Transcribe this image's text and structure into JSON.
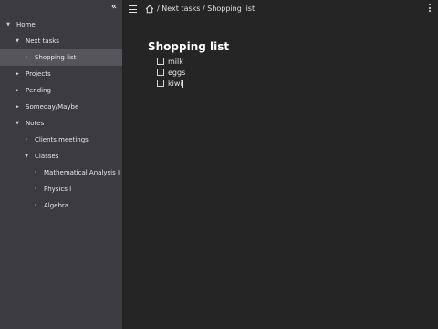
{
  "sidebar": {
    "collapse_icon": "chevron-double-left-icon",
    "items": [
      {
        "id": "home",
        "label": "Home",
        "expanded": true
      },
      {
        "id": "next-tasks",
        "label": "Next tasks",
        "expanded": true
      },
      {
        "id": "shopping-list",
        "label": "Shopping list",
        "selected": true
      },
      {
        "id": "projects",
        "label": "Projects",
        "expanded": false
      },
      {
        "id": "pending",
        "label": "Pending",
        "expanded": false
      },
      {
        "id": "someday-maybe",
        "label": "Someday/Maybe",
        "expanded": false
      },
      {
        "id": "notes",
        "label": "Notes",
        "expanded": true
      },
      {
        "id": "clients-meetings",
        "label": "Clients meetings"
      },
      {
        "id": "classes",
        "label": "Classes",
        "expanded": true
      },
      {
        "id": "mathematical-analysis-i",
        "label": "Mathematical Analysis I"
      },
      {
        "id": "physics-i",
        "label": "Physics I"
      },
      {
        "id": "algebra",
        "label": "Algebra"
      }
    ]
  },
  "topbar": {
    "menu_icon": "hamburger-menu-icon",
    "home_icon": "home-icon",
    "breadcrumb": [
      {
        "label": "Next tasks"
      },
      {
        "label": "Shopping list"
      }
    ],
    "separator": "/",
    "more_icon": "vertical-ellipsis-icon"
  },
  "page": {
    "title": "Shopping list",
    "checklist": [
      {
        "label": "milk",
        "checked": false
      },
      {
        "label": "eggs",
        "checked": false
      },
      {
        "label": "kiwi",
        "checked": false,
        "cursor": true
      }
    ]
  },
  "colors": {
    "sidebar_bg": "#3b3b40",
    "sidebar_selected_bg": "#55555b",
    "main_bg": "#252526",
    "text": "#e6e6e6"
  }
}
